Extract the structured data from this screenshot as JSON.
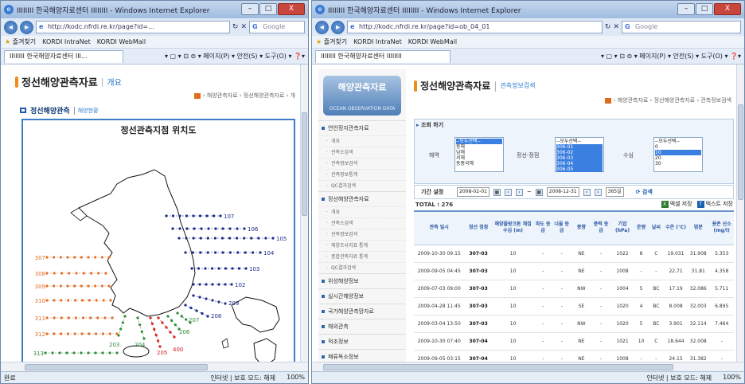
{
  "left_window": {
    "title": "IIIIIIII 한국해양자료센터 IIIIIIII - Windows Internet Explorer",
    "controls": {
      "min": "–",
      "max": "□",
      "close": "X"
    },
    "address": "http://kodc.nfrdi.re.kr/page?id=...",
    "search_placeholder": "Google",
    "favorites_label": "즐겨찾기",
    "favorites": [
      "KORDI IntraNet",
      "KORDI WebMail"
    ],
    "tab_label": "IIIIIIII 한국해양자료센터 III...",
    "toolbar_tools": "▾ ▢ ▾ ⊡ ⊜ ▾ 페이지(P) ▾ 안전(S) ▾ 도구(O) ▾ ❓▾",
    "page_title": "정선해양관측자료",
    "page_subtitle": "개요",
    "breadcrumb": "› 해양관측자료 › 정선해양관측자료 › 개",
    "section_title": "정선해양관측",
    "section_sub": "해양현황",
    "map_title": "정선관측지점 위치도",
    "line_labels": [
      "107",
      "106",
      "105",
      "104",
      "103",
      "102",
      "209",
      "208",
      "207",
      "206",
      "205",
      "400",
      "204",
      "203",
      "307",
      "308",
      "309",
      "310",
      "311",
      "312",
      "313",
      "314",
      "315",
      "316",
      "317"
    ],
    "status_text": "완료",
    "status_zone": "인터넷 | 보호 모드: 해제",
    "zoom": "100%"
  },
  "right_window": {
    "title": "IIIIIIII 한국해양자료센터 IIIIIIII - Windows Internet Explorer",
    "controls": {
      "min": "–",
      "max": "□",
      "close": "X"
    },
    "address": "http://kodc.nfrdi.re.kr/page?id=ob_04_01",
    "search_placeholder": "Google",
    "favorites_label": "즐겨찾기",
    "favorites": [
      "KORDI IntraNet",
      "KORDI WebMail"
    ],
    "tab_label": "IIIIIIII 한국해양자료센터 IIIIIIII",
    "toolbar_tools": "▾ ▢ ▾ ⊡ ⊜ ▾ 페이지(P) ▾ 안전(S) ▾ 도구(O) ▾ ❓▾",
    "logo_text": "해양관측자료",
    "logo_small": "OCEAN OBSERVATION DATA",
    "nav_groups": [
      {
        "label": "연안정지관측자료",
        "items": [
          "개요",
          "관측소검색",
          "관측정보검색",
          "관측정보통계",
          "QC결과검색"
        ]
      },
      {
        "label": "정선해양관측자료",
        "items": [
          "개요",
          "관측소검색",
          "관측정보검색",
          "해양조사지표 통계",
          "종합관측자료 통계",
          "QC결과검색"
        ]
      },
      {
        "label": "위성해양정보",
        "items": []
      },
      {
        "label": "실시간해양정보",
        "items": []
      },
      {
        "label": "국가해양관측망자료",
        "items": []
      },
      {
        "label": "해외관측",
        "items": []
      },
      {
        "label": "적조정보",
        "items": []
      },
      {
        "label": "패류독소정보",
        "items": []
      },
      {
        "label": "해파리속보",
        "items": []
      }
    ],
    "page_title": "정선해양관측자료",
    "page_subtitle": "관측정보검색",
    "breadcrumb": "› 해양관측자료 › 정선해양관측자료 › 관측정보검색",
    "cond_title": "조회 하기",
    "cond_sea_label": "해역",
    "cond_line_label": "정선-정점",
    "cond_depth_label": "수심",
    "sea_options": [
      "--모두선택--",
      "동해",
      "남해",
      "서해",
      "동중국해"
    ],
    "line_options": [
      "--모두선택--",
      "306-01",
      "306-02",
      "306-03",
      "306-04",
      "306-05"
    ],
    "depth_options": [
      "--모두선택--",
      "0",
      "10",
      "20",
      "30"
    ],
    "period_label": "기간 설정",
    "date_from": "2008-02-01",
    "date_to": "2008-12-31",
    "days": "365일",
    "search_btn": "검색",
    "total_label": "TOTAL : 276",
    "excel_label": "엑셀 저장",
    "text_label": "텍스트 저장",
    "table": {
      "headers": [
        "관측 일시",
        "정선 정점",
        "해양플랑크톤 채집수심 (m)",
        "파도 등급",
        "너울 등급",
        "풍향",
        "풍력 등급",
        "기압 (hPa)",
        "운량",
        "날씨",
        "수온 (℃)",
        "염분",
        "용존 산소 (mg/l)"
      ],
      "rows": [
        [
          "2009-10-30 09:15",
          "307-03",
          "10",
          "-",
          "-",
          "NE",
          "-",
          "1022",
          "8",
          "C",
          "19.031",
          "31.908",
          "5.353"
        ],
        [
          "2009-09-05 04:45",
          "307-03",
          "10",
          "-",
          "-",
          "NE",
          "-",
          "1008",
          "-",
          "-",
          "22.71",
          "31.81",
          "4.358"
        ],
        [
          "2009-07-03 09:00",
          "307-03",
          "10",
          "-",
          "-",
          "NW",
          "-",
          "1004",
          "5",
          "BC",
          "17.19",
          "32.086",
          "5.711"
        ],
        [
          "2009-04-28 11:45",
          "307-03",
          "10",
          "-",
          "-",
          "SE",
          "-",
          "1020",
          "4",
          "BC",
          "8.008",
          "32.003",
          "6.895"
        ],
        [
          "2009-03-04 13:50",
          "307-03",
          "10",
          "-",
          "-",
          "NW",
          "-",
          "1020",
          "5",
          "BC",
          "3.901",
          "32.114",
          "7.464"
        ],
        [
          "2009-10-30 07:40",
          "307-04",
          "10",
          "-",
          "-",
          "NE",
          "-",
          "1021",
          "10",
          "C",
          "18.644",
          "32.008",
          "-"
        ],
        [
          "2009-09-05 03:15",
          "307-04",
          "10",
          "-",
          "-",
          "NE",
          "-",
          "1008",
          "-",
          "-",
          "24.15",
          "31.382",
          "-"
        ]
      ]
    },
    "status_zone": "인터넷 | 보호 모드: 해제",
    "zoom": "100%"
  },
  "colors": {
    "accent": "#f08c1a",
    "link": "#1d6fc4",
    "map_border": "#3c7ec5",
    "line_blue": "#1a2b8a",
    "line_orange": "#e0702a",
    "line_green": "#2e8b3a",
    "line_red": "#d42020"
  }
}
